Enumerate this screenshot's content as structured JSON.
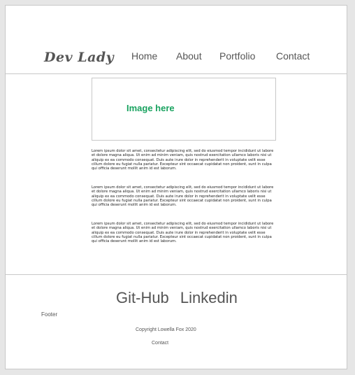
{
  "header": {
    "logo": "Dev Lady",
    "nav": [
      "Home",
      "About",
      "Portfolio",
      "Contact"
    ]
  },
  "main": {
    "image_placeholder": "Image here",
    "paragraphs": [
      "Lorem ipsum dolor sit amet, consectetur adipiscing elit, sed do eiusmod tempor incididunt ut labore et dolore magna aliqua. Ut enim ad minim veniam, quis nostrud exercitation ullamco laboris nisi ut aliquip ex ea commodo consequat. Duis aute irure dolor in reprehenderit in voluptate velit esse cillum dolore eu fugiat nulla pariatur. Excepteur sint occaecat cupidatat non proident, sunt in culpa qui officia deserunt mollit anim id est laborum.",
      "Lorem ipsum dolor sit amet, consectetur adipiscing elit, sed do eiusmod tempor incididunt ut labore et dolore magna aliqua. Ut enim ad minim veniam, quis nostrud exercitation ullamco laboris nisi ut aliquip ex ea commodo consequat. Duis aute irure dolor in reprehenderit in voluptate velit esse cillum dolore eu fugiat nulla pariatur. Excepteur sint occaecat cupidatat non proident, sunt in culpa qui officia deserunt mollit anim id est laborum.",
      "Lorem ipsum dolor sit amet, consectetur adipiscing elit, sed do eiusmod tempor incididunt ut labore et dolore magna aliqua. Ut enim ad minim veniam, quis nostrud exercitation ullamco laboris nisi ut aliquip ex ea commodo consequat. Duis aute irure dolor in reprehenderit in voluptate velit esse cillum dolore eu fugiat nulla pariatur. Excepteur sint occaecat cupidatat non proident, sunt in culpa qui officia deserunt mollit anim id est laborum."
    ]
  },
  "footer": {
    "links": [
      "Git-Hub",
      "Linkedin"
    ],
    "label": "Footer",
    "copyright": "Copyright Lowella Fox 2020",
    "contact": "Contact"
  },
  "colors": {
    "accent_green": "#1aa360",
    "text_gray": "#555555",
    "border": "#c8c8c8"
  }
}
